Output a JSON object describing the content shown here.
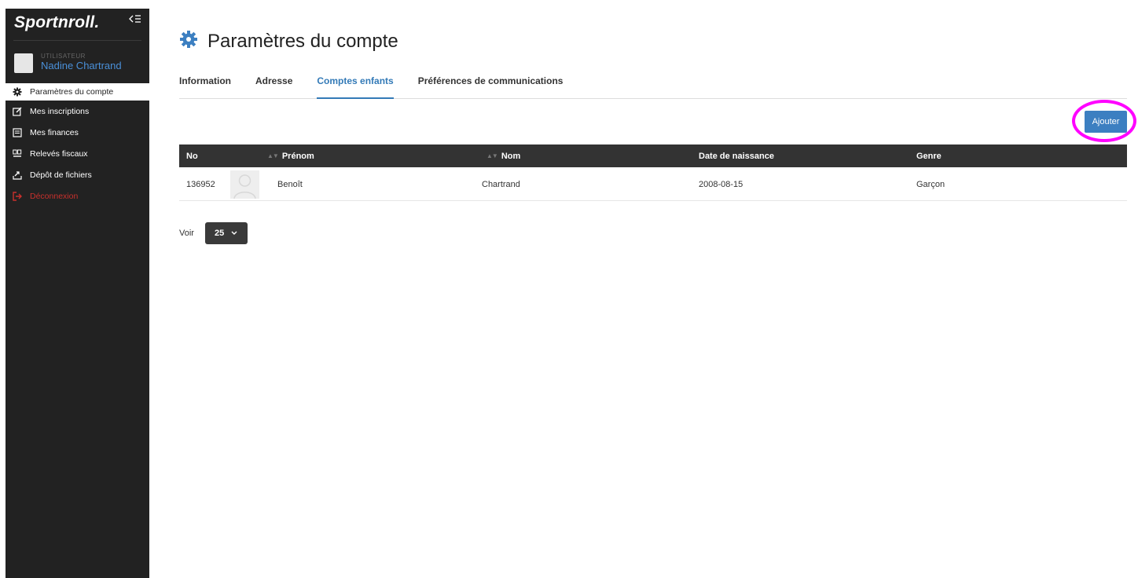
{
  "sidebar": {
    "brand": "Sportnroll.",
    "user_role": "UTILISATEUR",
    "user_name": "Nadine Chartrand",
    "items": [
      {
        "label": "Paramètres du compte",
        "icon": "gear-icon"
      },
      {
        "label": "Mes inscriptions",
        "icon": "edit-icon"
      },
      {
        "label": "Mes finances",
        "icon": "receipt-icon"
      },
      {
        "label": "Relevés fiscaux",
        "icon": "tax-icon"
      },
      {
        "label": "Dépôt de fichiers",
        "icon": "upload-icon"
      },
      {
        "label": "Déconnexion",
        "icon": "logout-icon"
      }
    ]
  },
  "header": {
    "title": "Paramètres du compte"
  },
  "tabs": [
    {
      "label": "Information"
    },
    {
      "label": "Adresse"
    },
    {
      "label": "Comptes enfants"
    },
    {
      "label": "Préférences de communications"
    }
  ],
  "toolbar": {
    "add_label": "Ajouter"
  },
  "table": {
    "headers": {
      "no": "No",
      "first_name": "Prénom",
      "last_name": "Nom",
      "birth_date": "Date de naissance",
      "gender": "Genre"
    },
    "rows": [
      {
        "no": "136952",
        "first_name": "Benoît",
        "last_name": "Chartrand",
        "birth_date": "2008-08-15",
        "gender": "Garçon"
      }
    ]
  },
  "pager": {
    "label": "Voir",
    "page_size": "25"
  },
  "colors": {
    "accent": "#337ab7",
    "sidebar_bg": "#222222",
    "highlight": "#ff00ff",
    "logout": "#c9302c"
  }
}
